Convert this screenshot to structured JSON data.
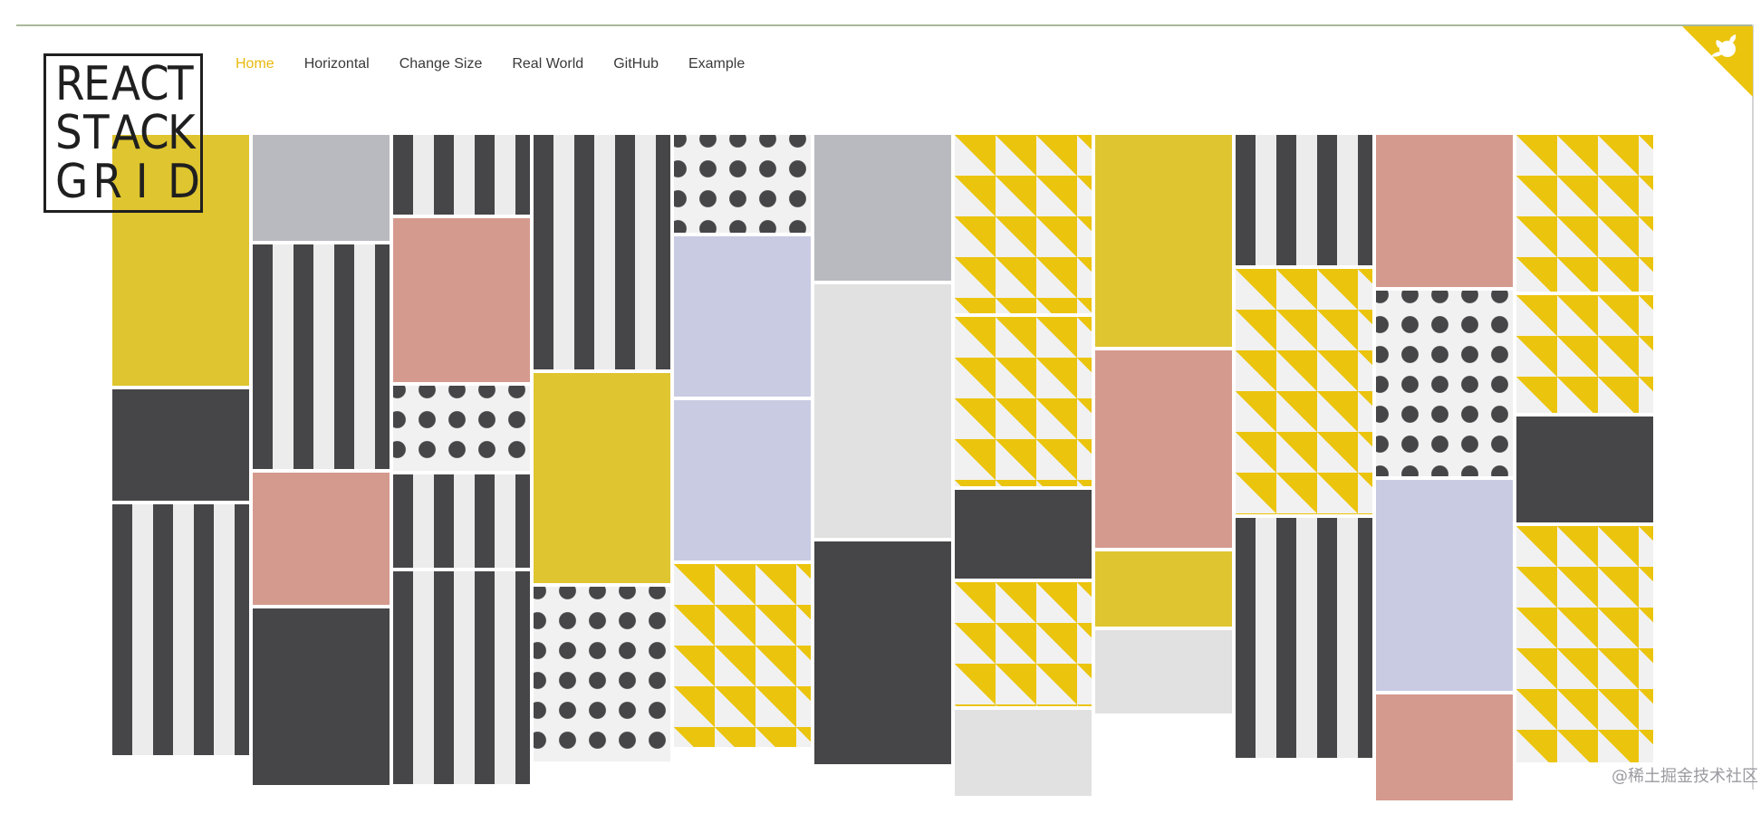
{
  "logo": {
    "line1": "REACT",
    "line2": "STACK",
    "line3": "GRID"
  },
  "nav": {
    "items": [
      {
        "label": "Home",
        "active": true
      },
      {
        "label": "Horizontal",
        "active": false
      },
      {
        "label": "Change Size",
        "active": false
      },
      {
        "label": "Real World",
        "active": false
      },
      {
        "label": "GitHub",
        "active": false
      },
      {
        "label": "Example",
        "active": false
      }
    ]
  },
  "corner_ribbon": {
    "icon": "github-octocat-icon",
    "color": "#ebc40d"
  },
  "watermark": "@稀土掘金技术社区",
  "colors": {
    "accent": "#e8b90b",
    "yellow": "#dfc52f",
    "dark": "#464648",
    "gray": "#b9bac0",
    "light": "#e1e1e1",
    "pink": "#d59a8e",
    "lavender": "#c9cbe3",
    "triangle_yellow": "#ebc40d"
  },
  "grid": {
    "columns": [
      [
        "yellow",
        "dark",
        "stripes"
      ],
      [
        "gray",
        "stripes",
        "pink",
        "dark"
      ],
      [
        "stripes",
        "pink",
        "dots",
        "stripes",
        "stripes"
      ],
      [
        "stripes",
        "yellow",
        "dots"
      ],
      [
        "dots",
        "lavender",
        "lavender",
        "triangles"
      ],
      [
        "gray",
        "light",
        "dark"
      ],
      [
        "triangles",
        "triangles",
        "dark",
        "triangles",
        "light"
      ],
      [
        "yellow",
        "pink",
        "yellow",
        "light"
      ],
      [
        "stripes",
        "triangles",
        "stripes"
      ],
      [
        "pink",
        "dots",
        "lavender",
        "pink"
      ],
      [
        "triangles",
        "triangles",
        "dark",
        "triangles"
      ]
    ]
  }
}
